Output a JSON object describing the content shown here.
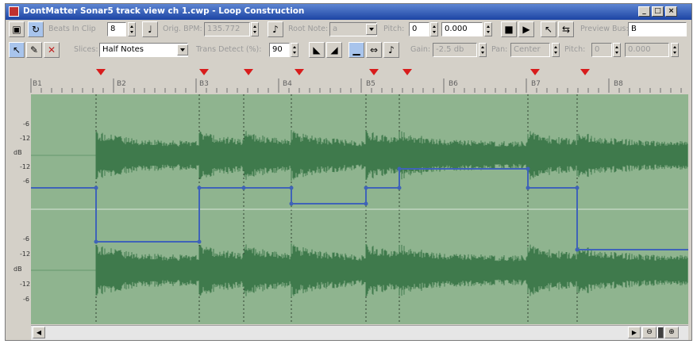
{
  "window": {
    "title": "DontMatter Sonar5 track view ch 1.cwp - Loop Construction",
    "controls": [
      "_",
      "□",
      "×"
    ]
  },
  "toolbar1": {
    "beats_label": "Beats In Clip",
    "beats_value": "8",
    "bpm_label": "Orig. BPM:",
    "bpm_value": "135.772",
    "root_label": "Root Note:",
    "root_value": "a",
    "pitch_label": "Pitch:",
    "pitch_value": "0",
    "pitch_fine": "0.000",
    "preview_label": "Preview Bus:",
    "preview_value": "B"
  },
  "toolbar2": {
    "slices_label": "Slices:",
    "slices_value": "Half Notes",
    "trans_label": "Trans Detect (%):",
    "trans_value": "90",
    "gain_label": "Gain:",
    "gain_value": "-2.5 db",
    "pan_label": "Pan:",
    "pan_value": "Center",
    "pitch2_label": "Pitch:",
    "pitch2_value": "0",
    "pitch2_fine": "0.000"
  },
  "ruler": {
    "markers": [
      "B1",
      "B2",
      "B3",
      "B4",
      "B5",
      "B6",
      "B7",
      "B8"
    ]
  },
  "db_labels_top": [
    "-6",
    "-12",
    "dB",
    "-12",
    "-6"
  ],
  "db_labels_bot": [
    "-6",
    "-12",
    "dB",
    "-12",
    "-6"
  ],
  "colors": {
    "track_bg": "#8fb48f",
    "wave": "#3f7a4c",
    "env": "#3f63b8",
    "slice_marker": "#d81c1c"
  },
  "icons": [
    "save-icon",
    "select-icon",
    "pencil-icon",
    "erase-icon",
    "play-icon",
    "stop-icon",
    "zoom-in-icon",
    "zoom-out-icon"
  ]
}
